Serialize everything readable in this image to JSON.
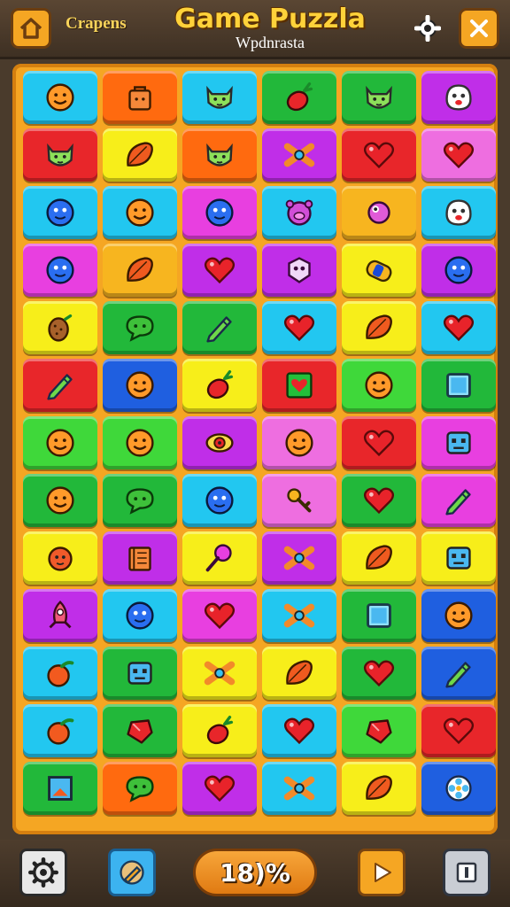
{
  "header": {
    "left_label": "Crapens",
    "title": "Game Puzzla",
    "subtitle": "Wpdnrasta"
  },
  "footer": {
    "progress_text": "18)%"
  },
  "colors": {
    "cyan": "#22c7f0",
    "orange": "#ff6a0f",
    "green": "#22b83a",
    "purple": "#c02ee8",
    "red": "#e8262a",
    "yellow": "#f7ee1a",
    "pink": "#ee6ee0",
    "magenta": "#e83fe0",
    "blue": "#1f5fe0",
    "lime": "#3fd83a",
    "gold": "#f7b51f"
  },
  "board": {
    "rows": [
      [
        {
          "color": "cyan",
          "icon": "smiley-face-icon"
        },
        {
          "color": "orange",
          "icon": "bag-icon"
        },
        {
          "color": "cyan",
          "icon": "cat-face-icon"
        },
        {
          "color": "green",
          "icon": "radish-icon"
        },
        {
          "color": "green",
          "icon": "cat-face-icon"
        },
        {
          "color": "purple",
          "icon": "ghost-face-icon"
        }
      ],
      [
        {
          "color": "red",
          "icon": "cat-face-icon"
        },
        {
          "color": "yellow",
          "icon": "leaf-icon"
        },
        {
          "color": "orange",
          "icon": "cat-face-icon"
        },
        {
          "color": "purple",
          "icon": "bow-icon"
        },
        {
          "color": "red",
          "icon": "heart-icon"
        },
        {
          "color": "pink",
          "icon": "heart-icon"
        }
      ],
      [
        {
          "color": "cyan",
          "icon": "blob-face-icon"
        },
        {
          "color": "cyan",
          "icon": "smiley-face-icon"
        },
        {
          "color": "magenta",
          "icon": "blob-face-icon"
        },
        {
          "color": "cyan",
          "icon": "pig-face-icon"
        },
        {
          "color": "gold",
          "icon": "candy-icon"
        },
        {
          "color": "cyan",
          "icon": "ghost-face-icon"
        }
      ],
      [
        {
          "color": "magenta",
          "icon": "blob-face-icon"
        },
        {
          "color": "gold",
          "icon": "leaf-icon"
        },
        {
          "color": "purple",
          "icon": "heart-icon"
        },
        {
          "color": "purple",
          "icon": "gem-face-icon"
        },
        {
          "color": "yellow",
          "icon": "sushi-icon"
        },
        {
          "color": "purple",
          "icon": "blob-face-icon"
        }
      ],
      [
        {
          "color": "yellow",
          "icon": "pinecone-icon"
        },
        {
          "color": "green",
          "icon": "chat-bubble-icon"
        },
        {
          "color": "green",
          "icon": "pencil-icon"
        },
        {
          "color": "cyan",
          "icon": "heart-icon"
        },
        {
          "color": "yellow",
          "icon": "leaf-icon"
        },
        {
          "color": "cyan",
          "icon": "heart-icon"
        }
      ],
      [
        {
          "color": "red",
          "icon": "pencil-icon"
        },
        {
          "color": "blue",
          "icon": "smiley-face-icon"
        },
        {
          "color": "yellow",
          "icon": "radish-icon"
        },
        {
          "color": "red",
          "icon": "heart-square-icon"
        },
        {
          "color": "lime",
          "icon": "smiley-face-icon"
        },
        {
          "color": "green",
          "icon": "square-icon"
        }
      ],
      [
        {
          "color": "lime",
          "icon": "smiley-face-icon"
        },
        {
          "color": "lime",
          "icon": "smiley-face-icon"
        },
        {
          "color": "purple",
          "icon": "eye-icon"
        },
        {
          "color": "pink",
          "icon": "smiley-face-icon"
        },
        {
          "color": "red",
          "icon": "heart-icon"
        },
        {
          "color": "magenta",
          "icon": "robot-face-icon"
        }
      ],
      [
        {
          "color": "green",
          "icon": "smiley-face-icon"
        },
        {
          "color": "green",
          "icon": "chat-bubble-icon"
        },
        {
          "color": "cyan",
          "icon": "blob-face-icon"
        },
        {
          "color": "pink",
          "icon": "key-icon"
        },
        {
          "color": "green",
          "icon": "heart-icon"
        },
        {
          "color": "magenta",
          "icon": "pencil-icon"
        }
      ],
      [
        {
          "color": "yellow",
          "icon": "hedgehog-icon"
        },
        {
          "color": "purple",
          "icon": "book-icon"
        },
        {
          "color": "yellow",
          "icon": "pin-icon"
        },
        {
          "color": "purple",
          "icon": "bow-icon"
        },
        {
          "color": "yellow",
          "icon": "leaf-icon"
        },
        {
          "color": "yellow",
          "icon": "robot-face-icon"
        }
      ],
      [
        {
          "color": "purple",
          "icon": "rocket-icon"
        },
        {
          "color": "cyan",
          "icon": "blob-face-icon"
        },
        {
          "color": "magenta",
          "icon": "heart-icon"
        },
        {
          "color": "cyan",
          "icon": "bow-icon"
        },
        {
          "color": "green",
          "icon": "square-icon"
        },
        {
          "color": "blue",
          "icon": "smiley-face-icon"
        }
      ],
      [
        {
          "color": "cyan",
          "icon": "tomato-icon"
        },
        {
          "color": "green",
          "icon": "robot-face-icon"
        },
        {
          "color": "yellow",
          "icon": "bow-icon"
        },
        {
          "color": "yellow",
          "icon": "leaf-icon"
        },
        {
          "color": "green",
          "icon": "heart-icon"
        },
        {
          "color": "blue",
          "icon": "pencil-icon"
        }
      ],
      [
        {
          "color": "cyan",
          "icon": "tomato-icon"
        },
        {
          "color": "green",
          "icon": "gem-icon"
        },
        {
          "color": "yellow",
          "icon": "radish-icon"
        },
        {
          "color": "cyan",
          "icon": "heart-icon"
        },
        {
          "color": "lime",
          "icon": "gem-icon"
        },
        {
          "color": "red",
          "icon": "heart-icon"
        }
      ],
      [
        {
          "color": "green",
          "icon": "frame-icon"
        },
        {
          "color": "orange",
          "icon": "chat-bubble-icon"
        },
        {
          "color": "purple",
          "icon": "heart-icon"
        },
        {
          "color": "cyan",
          "icon": "bow-icon"
        },
        {
          "color": "yellow",
          "icon": "leaf-icon"
        },
        {
          "color": "blue",
          "icon": "flower-icon"
        }
      ]
    ]
  }
}
